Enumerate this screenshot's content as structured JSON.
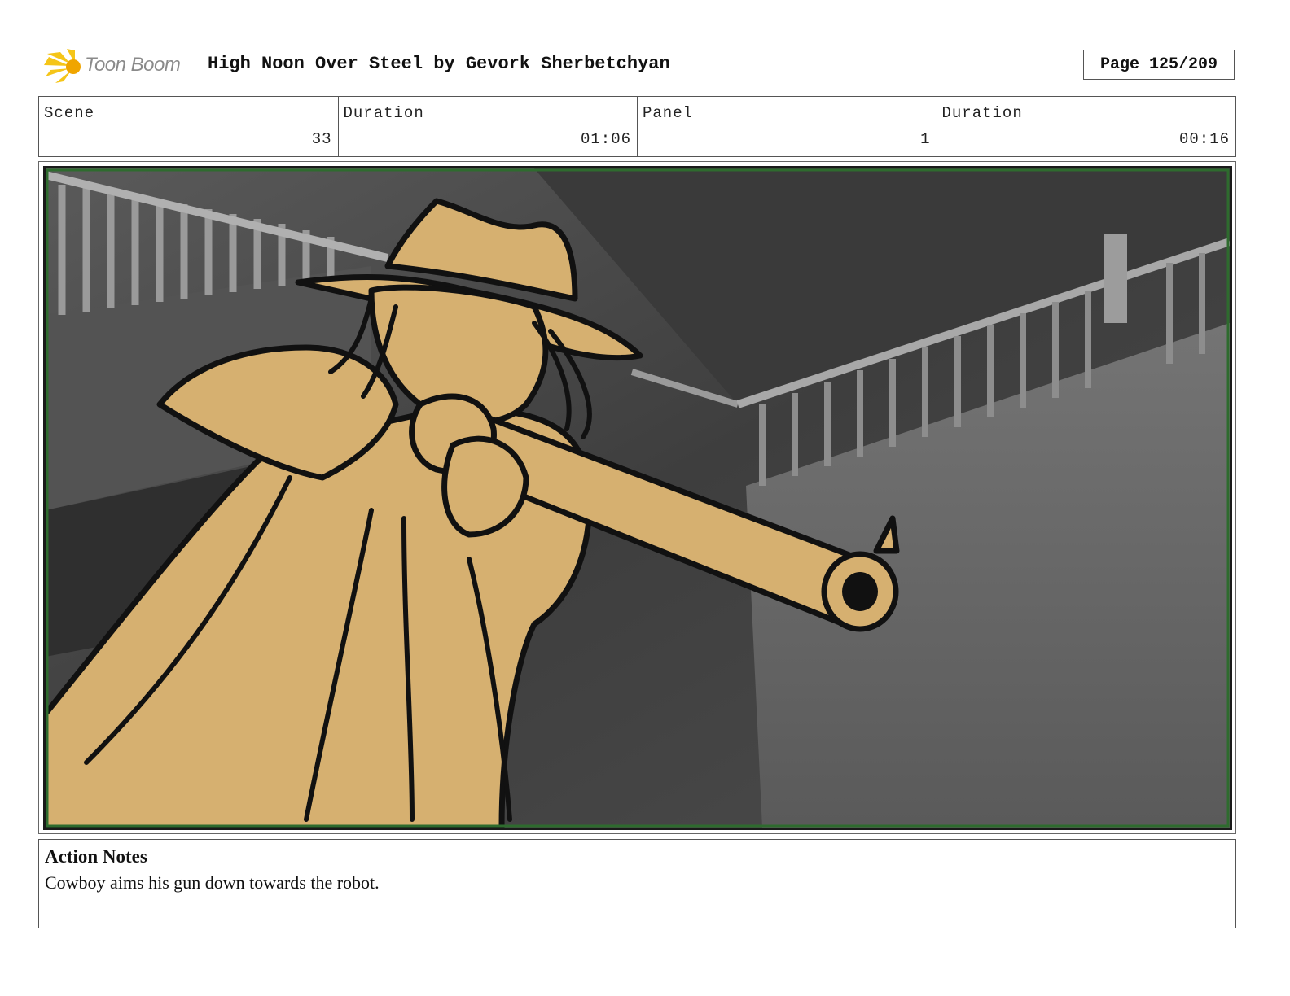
{
  "header": {
    "logo_text": "Toon Boom",
    "title": "High Noon Over Steel by Gevork Sherbetchyan",
    "page": "Page 125/209"
  },
  "info": [
    {
      "label": "Scene",
      "value": "33"
    },
    {
      "label": "Duration",
      "value": "01:06"
    },
    {
      "label": "Panel",
      "value": "1"
    },
    {
      "label": "Duration",
      "value": "00:16"
    }
  ],
  "panel": {
    "description_icon": "storyboard-drawing",
    "colors": {
      "figure": "#d6b070",
      "line": "#111111",
      "background": "#4a4a4a",
      "frame": "#2e6b2e"
    }
  },
  "notes": {
    "heading": "Action Notes",
    "text": "Cowboy aims his gun down towards the robot."
  }
}
